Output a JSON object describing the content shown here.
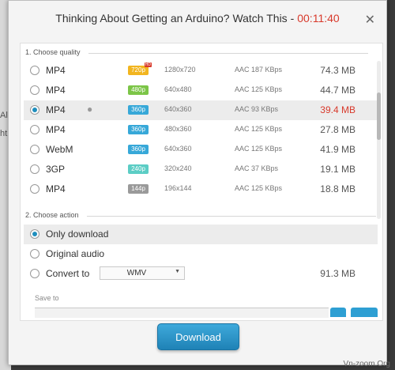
{
  "dialog": {
    "title": "Thinking About Getting an Arduino? Watch This -",
    "duration": "00:11:40"
  },
  "background_peek": [
    "Al",
    "ht"
  ],
  "quality": {
    "section_label": "1. Choose quality",
    "rows": [
      {
        "format": "MP4",
        "badge": "720p",
        "badge_color": "#f2b51f",
        "hd": true,
        "resolution": "1280x720",
        "audio": "AAC 187  KBps",
        "size": "74.3 MB",
        "selected": false,
        "apple": false
      },
      {
        "format": "MP4",
        "badge": "480p",
        "badge_color": "#7cc547",
        "hd": false,
        "resolution": "640x480",
        "audio": "AAC 125  KBps",
        "size": "44.7 MB",
        "selected": false,
        "apple": false
      },
      {
        "format": "MP4",
        "badge": "360p",
        "badge_color": "#37a8d8",
        "hd": false,
        "resolution": "640x360",
        "audio": "AAC 93  KBps",
        "size": "39.4 MB",
        "selected": true,
        "apple": true
      },
      {
        "format": "MP4",
        "badge": "360p",
        "badge_color": "#37a8d8",
        "hd": false,
        "resolution": "480x360",
        "audio": "AAC 125  KBps",
        "size": "27.8 MB",
        "selected": false,
        "apple": false
      },
      {
        "format": "WebM",
        "badge": "360p",
        "badge_color": "#37a8d8",
        "hd": false,
        "resolution": "640x360",
        "audio": "AAC 125  KBps",
        "size": "41.9 MB",
        "selected": false,
        "apple": false
      },
      {
        "format": "3GP",
        "badge": "240p",
        "badge_color": "#5ccdc5",
        "hd": false,
        "resolution": "320x240",
        "audio": "AAC 37  KBps",
        "size": "19.1 MB",
        "selected": false,
        "apple": false
      },
      {
        "format": "MP4",
        "badge": "144p",
        "badge_color": "#9a9a9a",
        "hd": false,
        "resolution": "196x144",
        "audio": "AAC 125  KBps",
        "size": "18.8 MB",
        "selected": false,
        "apple": false
      }
    ]
  },
  "action": {
    "section_label": "2. Choose action",
    "only_download": "Only download",
    "original_audio": "Original audio",
    "convert_to": "Convert to",
    "convert_format": "WMV",
    "convert_size": "91.3 MB",
    "selected": "only_download"
  },
  "save_to": {
    "label": "Save to"
  },
  "footer": {
    "download_label": "Download"
  },
  "watermark": "Vn-zoom.Org",
  "colors": {
    "accent": "#2e9fd3",
    "highlight": "#d8392b"
  }
}
